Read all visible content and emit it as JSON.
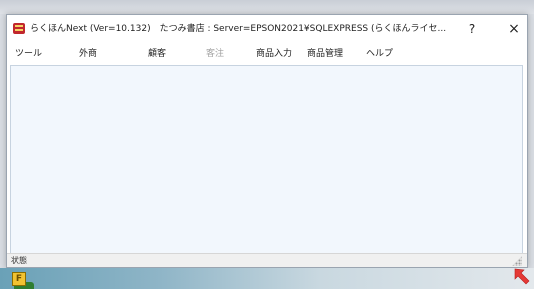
{
  "window": {
    "title": "らくほんNext (Ver=10.132)　たつみ書店 : Server=EPSON2021¥SQLEXPRESS (らくほんライセ...",
    "help_label": "?",
    "close_label": "×"
  },
  "menu": {
    "items": [
      {
        "label": "ツール",
        "enabled": true
      },
      {
        "label": "外商",
        "enabled": true
      },
      {
        "label": "顧客",
        "enabled": true
      },
      {
        "label": "客注",
        "enabled": false
      },
      {
        "label": "商品入力",
        "enabled": true
      },
      {
        "label": "商品管理",
        "enabled": true
      },
      {
        "label": "ヘルプ",
        "enabled": true
      }
    ]
  },
  "statusbar": {
    "text": "状態"
  },
  "taskbar": {
    "icon_letter": "F"
  },
  "colors": {
    "content_bg": "#f2f7fd",
    "app_icon": "#c1272d",
    "pointer_arrow": "#e53935"
  },
  "icons": {
    "app": "app-icon",
    "help": "question-mark-icon",
    "close": "close-icon",
    "grip": "resize-grip-icon",
    "pointer": "red-arrow-icon"
  }
}
